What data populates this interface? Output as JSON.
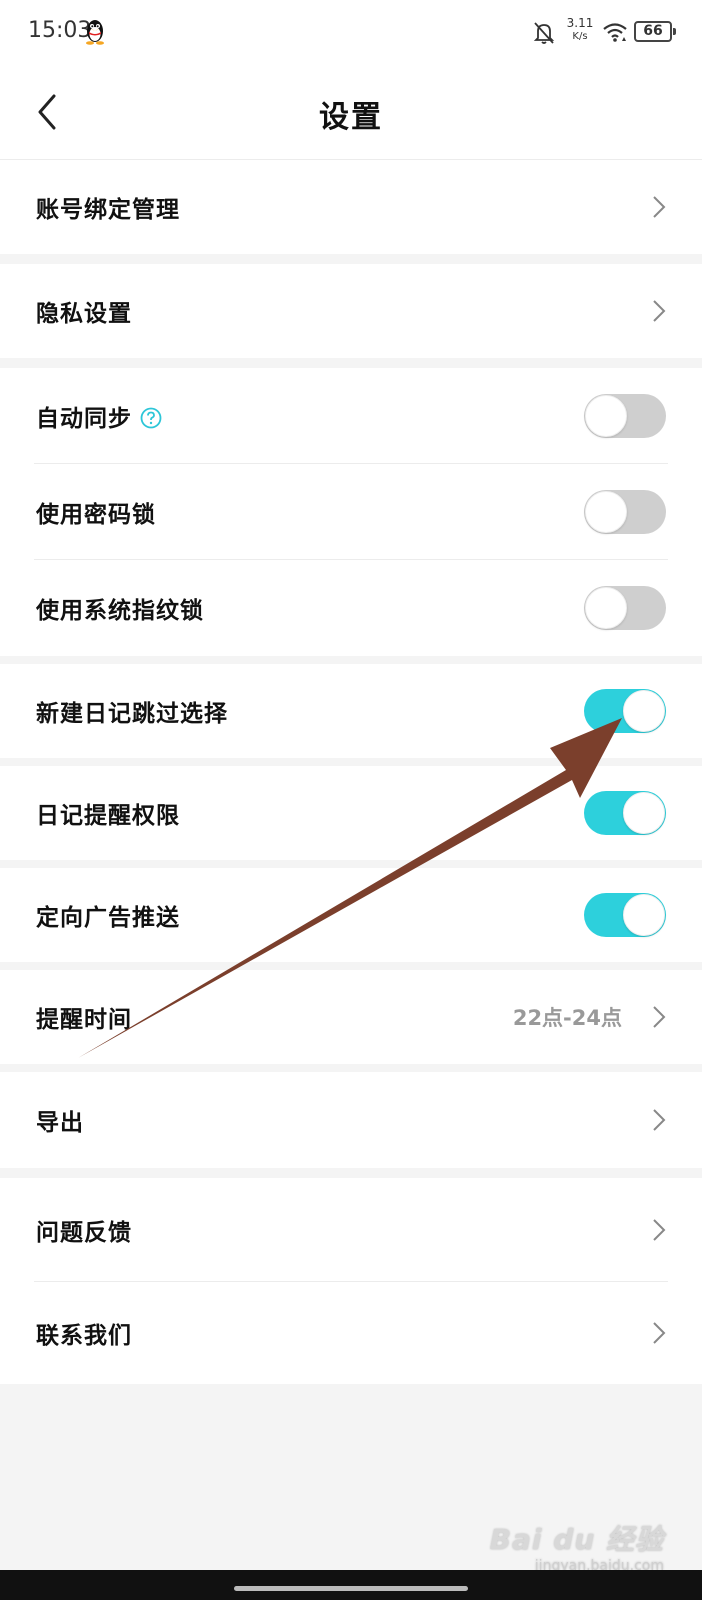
{
  "status_bar": {
    "time": "15:03",
    "net_speed_value": "3.11",
    "net_speed_unit": "K/s",
    "battery": "66"
  },
  "header": {
    "title": "设置"
  },
  "rows": [
    {
      "label": "账号绑定管理",
      "type": "link"
    },
    {
      "label": "隐私设置",
      "type": "link"
    },
    {
      "label": "自动同步",
      "type": "toggle",
      "on": false,
      "help": true
    },
    {
      "label": "使用密码锁",
      "type": "toggle",
      "on": false
    },
    {
      "label": "使用系统指纹锁",
      "type": "toggle",
      "on": false
    },
    {
      "label": "新建日记跳过选择",
      "type": "toggle",
      "on": true
    },
    {
      "label": "日记提醒权限",
      "type": "toggle",
      "on": true
    },
    {
      "label": "定向广告推送",
      "type": "toggle",
      "on": true
    },
    {
      "label": "提醒时间",
      "type": "link",
      "value": "22点-24点"
    },
    {
      "label": "导出",
      "type": "link"
    },
    {
      "label": "问题反馈",
      "type": "link"
    },
    {
      "label": "联系我们",
      "type": "link"
    }
  ],
  "watermark": {
    "logo": "Bai du 经验",
    "url": "jingyan.baidu.com"
  },
  "colors": {
    "toggle_on": "#2dd0dc",
    "toggle_off": "#cfcfcf",
    "annotation_arrow": "#7b3f2c"
  },
  "icons": [
    "qq-icon",
    "bell-off-icon",
    "wifi-icon",
    "back-arrow-icon",
    "chevron-right-icon",
    "help-circle-icon"
  ]
}
